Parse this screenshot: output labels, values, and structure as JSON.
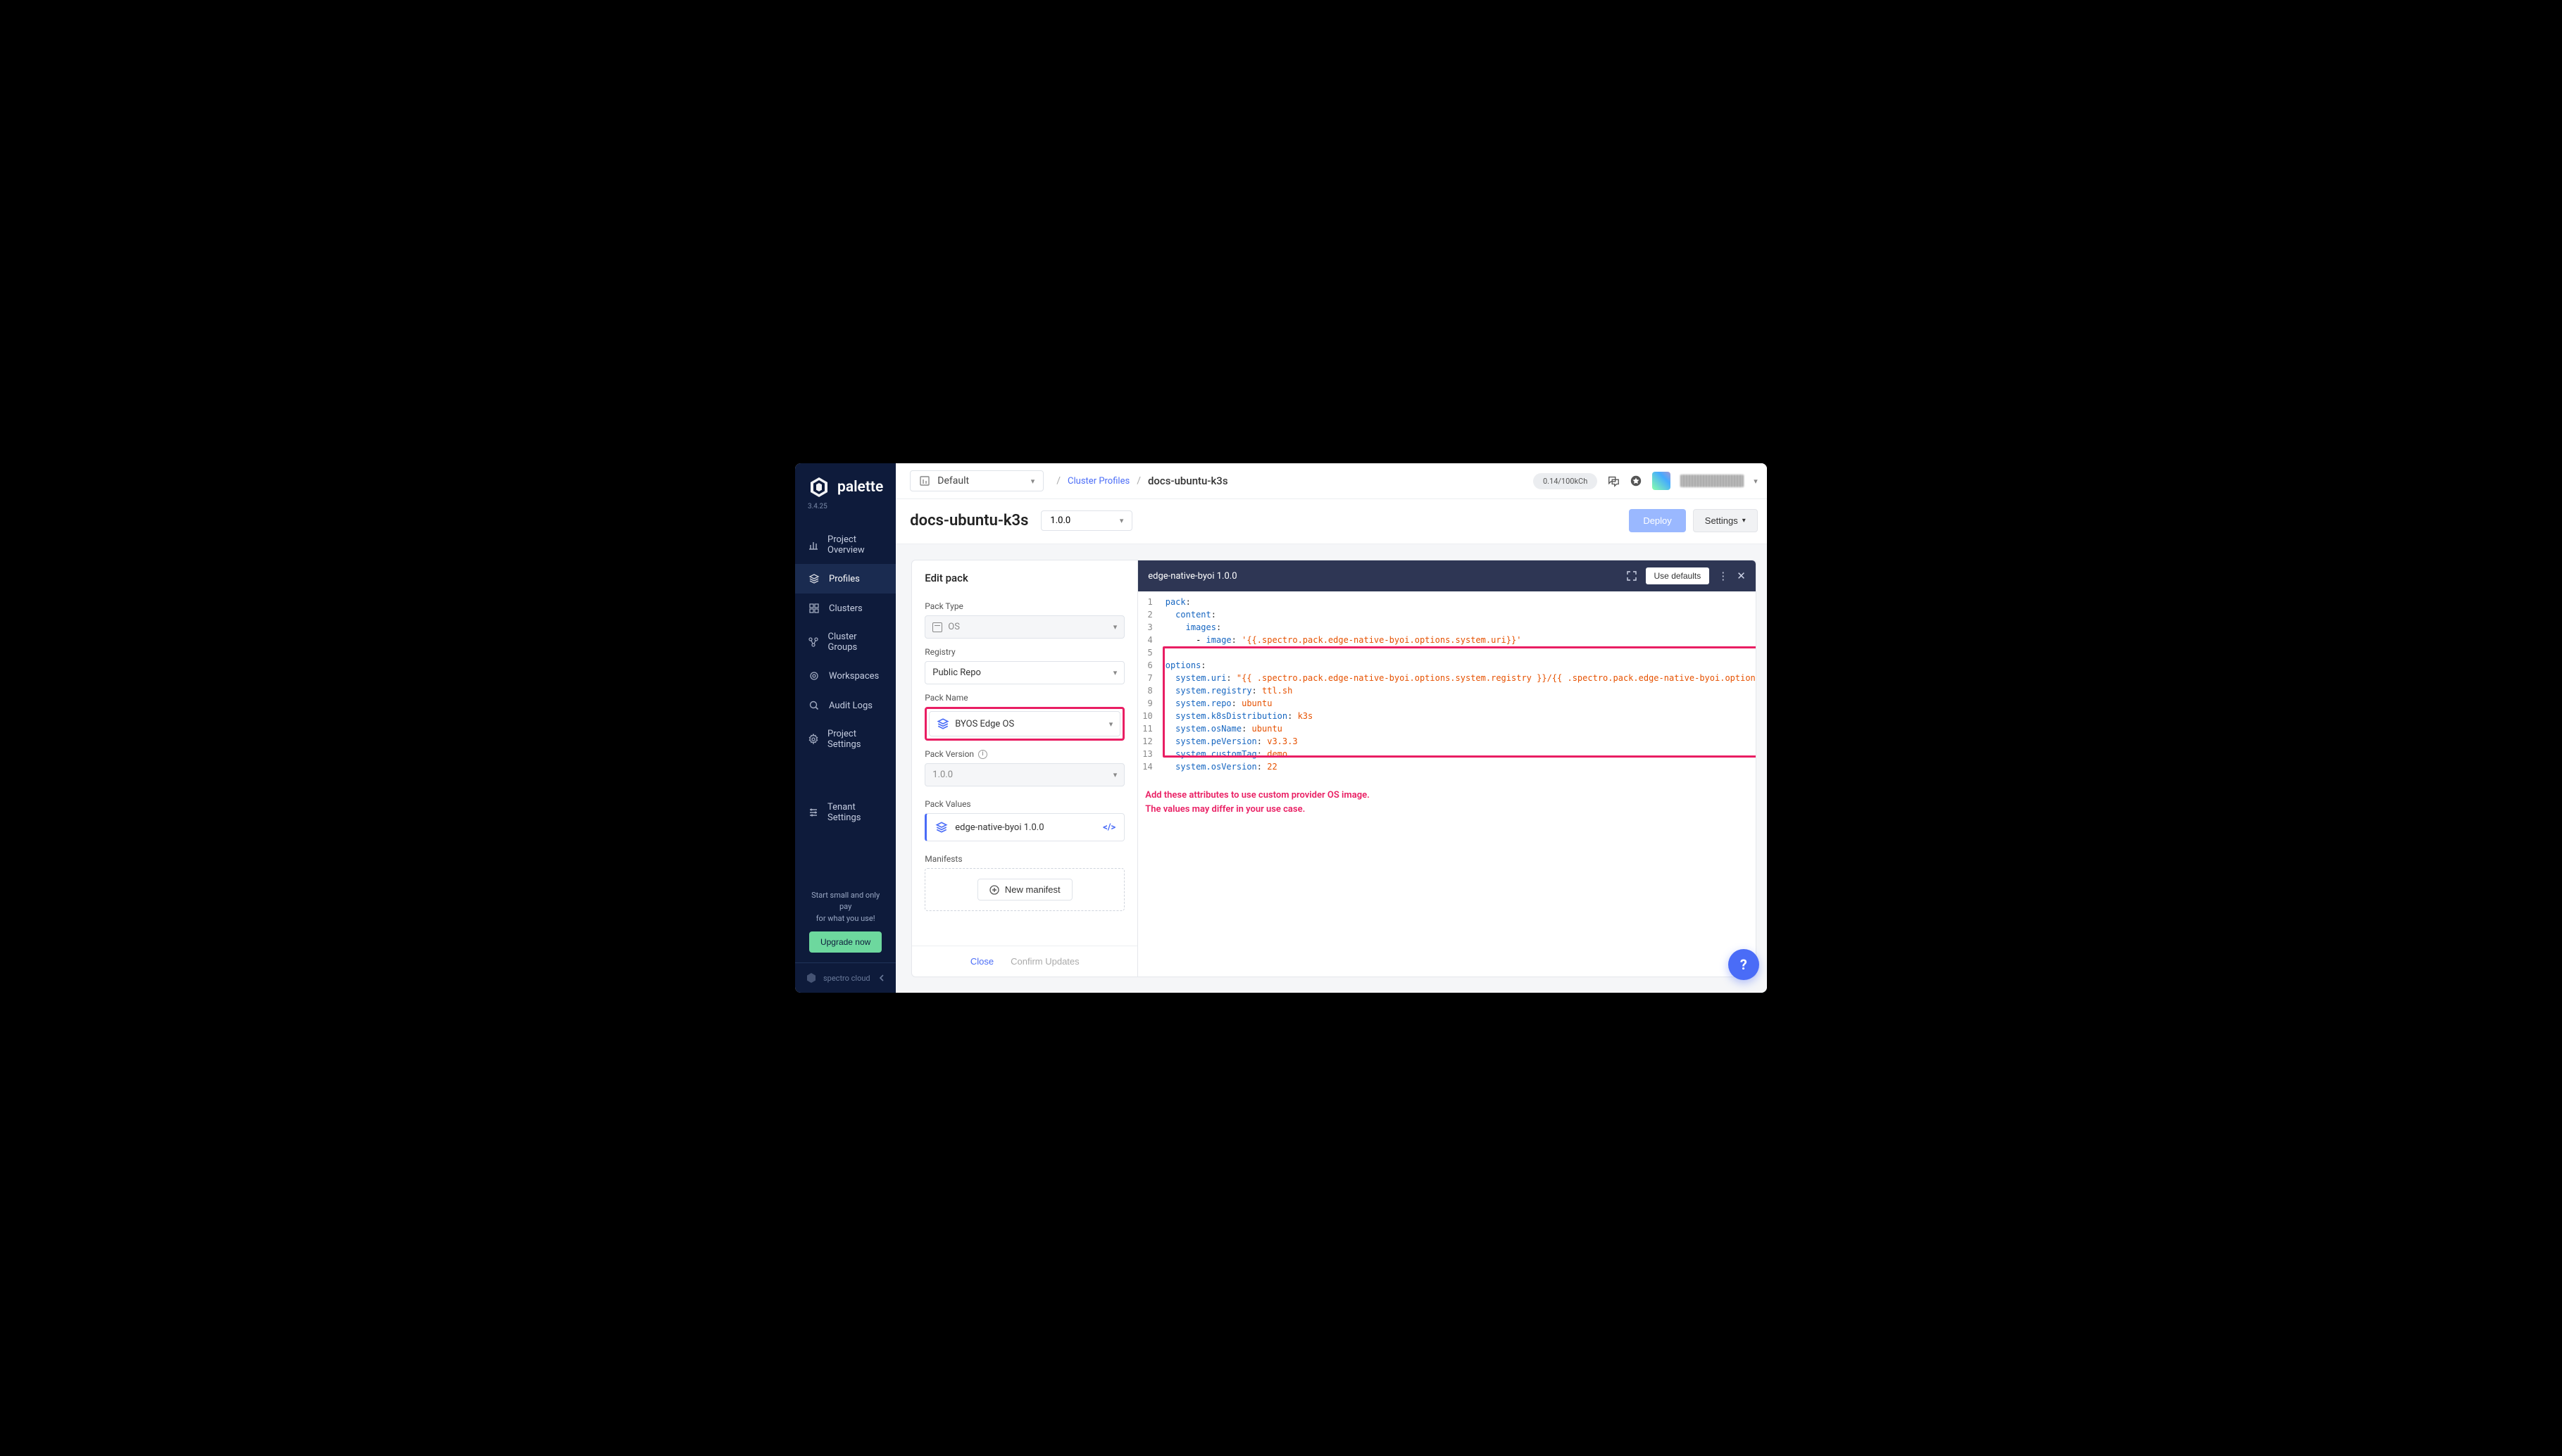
{
  "brand": {
    "name": "palette",
    "version": "3.4.25",
    "company": "spectro cloud"
  },
  "sidebar": {
    "items": [
      {
        "label": "Project Overview",
        "icon": "chart-icon"
      },
      {
        "label": "Profiles",
        "icon": "layers-icon",
        "active": true
      },
      {
        "label": "Clusters",
        "icon": "grid-icon"
      },
      {
        "label": "Cluster Groups",
        "icon": "network-icon"
      },
      {
        "label": "Workspaces",
        "icon": "gear-icon"
      },
      {
        "label": "Audit Logs",
        "icon": "search-icon"
      },
      {
        "label": "Project Settings",
        "icon": "cog-icon"
      },
      {
        "label": "Tenant Settings",
        "icon": "sliders-icon"
      }
    ],
    "cta_line1": "Start small and only pay",
    "cta_line2": "for what you use!",
    "upgrade_label": "Upgrade now"
  },
  "topbar": {
    "project": "Default",
    "breadcrumb_link": "Cluster Profiles",
    "breadcrumb_current": "docs-ubuntu-k3s",
    "usage": "0.14/100kCh"
  },
  "header": {
    "title": "docs-ubuntu-k3s",
    "version": "1.0.0",
    "deploy_label": "Deploy",
    "settings_label": "Settings"
  },
  "edit_panel": {
    "title": "Edit pack",
    "pack_type_label": "Pack Type",
    "pack_type_value": "OS",
    "registry_label": "Registry",
    "registry_value": "Public Repo",
    "pack_name_label": "Pack Name",
    "pack_name_value": "BYOS Edge OS",
    "pack_version_label": "Pack Version",
    "pack_version_value": "1.0.0",
    "pack_values_label": "Pack Values",
    "pack_value_item": "edge-native-byoi 1.0.0",
    "manifests_label": "Manifests",
    "new_manifest_label": "New manifest",
    "close_label": "Close",
    "confirm_label": "Confirm Updates"
  },
  "editor": {
    "title": "edge-native-byoi 1.0.0",
    "use_defaults_label": "Use defaults",
    "annotation_line1": "Add these attributes to use custom provider OS image.",
    "annotation_line2": "The values may differ in your use case.",
    "lines": [
      {
        "n": 1,
        "key": "pack",
        "punc": ":"
      },
      {
        "n": 2,
        "indent": "  ",
        "key": "content",
        "punc": ":"
      },
      {
        "n": 3,
        "indent": "    ",
        "key": "images",
        "punc": ":"
      },
      {
        "n": 4,
        "indent": "      ",
        "prefix": "- ",
        "key": "image",
        "punc": ": ",
        "str": "'{{.spectro.pack.edge-native-byoi.options.system.uri}}'"
      },
      {
        "n": 5,
        "blank": true
      },
      {
        "n": 6,
        "key": "options",
        "punc": ":"
      },
      {
        "n": 7,
        "indent": "  ",
        "key": "system.uri",
        "punc": ": ",
        "str": "\"{{ .spectro.pack.edge-native-byoi.options.system.registry }}/{{ .spectro.pack.edge-native-byoi.option"
      },
      {
        "n": 8,
        "indent": "  ",
        "key": "system.registry",
        "punc": ": ",
        "str": "ttl.sh"
      },
      {
        "n": 9,
        "indent": "  ",
        "key": "system.repo",
        "punc": ": ",
        "str": "ubuntu"
      },
      {
        "n": 10,
        "indent": "  ",
        "key": "system.k8sDistribution",
        "punc": ": ",
        "str": "k3s"
      },
      {
        "n": 11,
        "indent": "  ",
        "key": "system.osName",
        "punc": ": ",
        "str": "ubuntu"
      },
      {
        "n": 12,
        "indent": "  ",
        "key": "system.peVersion",
        "punc": ": ",
        "str": "v3.3.3"
      },
      {
        "n": 13,
        "indent": "  ",
        "key": "system.customTag",
        "punc": ": ",
        "str": "demo"
      },
      {
        "n": 14,
        "indent": "  ",
        "key": "system.osVersion",
        "punc": ": ",
        "str": "22"
      }
    ]
  }
}
